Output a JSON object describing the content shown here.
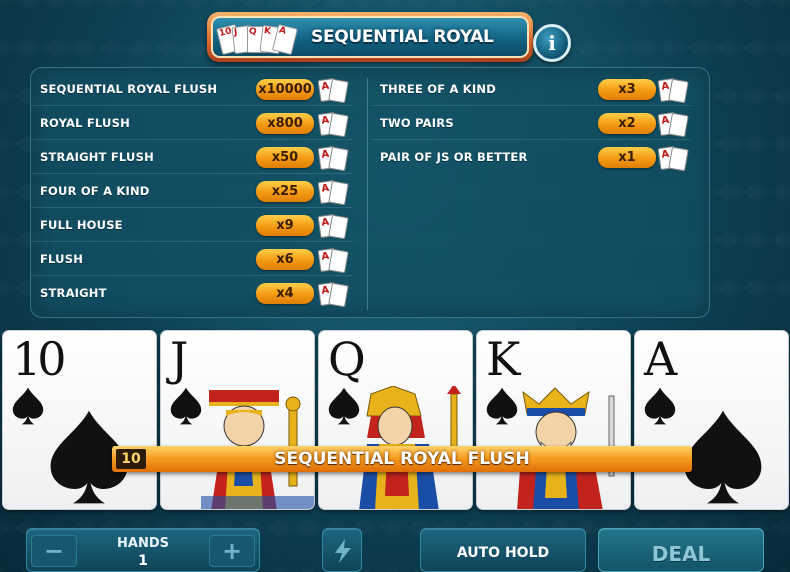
{
  "banner": {
    "title": "SEQUENTIAL ROYAL",
    "mini_cards": [
      "10",
      "J",
      "Q",
      "K",
      "A"
    ]
  },
  "info_button": {
    "label": "i"
  },
  "paytable": {
    "left": [
      {
        "name": "SEQUENTIAL ROYAL FLUSH",
        "multiplier": "x10000"
      },
      {
        "name": "ROYAL FLUSH",
        "multiplier": "x800"
      },
      {
        "name": "STRAIGHT FLUSH",
        "multiplier": "x50"
      },
      {
        "name": "FOUR OF A KIND",
        "multiplier": "x25"
      },
      {
        "name": "FULL HOUSE",
        "multiplier": "x9"
      },
      {
        "name": "FLUSH",
        "multiplier": "x6"
      },
      {
        "name": "STRAIGHT",
        "multiplier": "x4"
      }
    ],
    "right": [
      {
        "name": "THREE OF A KIND",
        "multiplier": "x3"
      },
      {
        "name": "TWO PAIRS",
        "multiplier": "x2"
      },
      {
        "name": "PAIR OF JS OR BETTER",
        "multiplier": "x1"
      }
    ],
    "icon_card_letter": "A"
  },
  "cards": [
    {
      "rank": "10",
      "suit": "spade"
    },
    {
      "rank": "J",
      "suit": "spade"
    },
    {
      "rank": "Q",
      "suit": "spade"
    },
    {
      "rank": "K",
      "suit": "spade"
    },
    {
      "rank": "A",
      "suit": "spade"
    }
  ],
  "win": {
    "hand_number": "10",
    "text": "SEQUENTIAL ROYAL FLUSH"
  },
  "controls": {
    "hands_label": "HANDS",
    "hands_value": "1",
    "minus": "−",
    "plus": "+",
    "auto_hold": "AUTO HOLD",
    "deal": "DEAL"
  },
  "colors": {
    "accent_orange": "#f59a1e",
    "panel_teal": "#124e62",
    "background": "#0d4054"
  }
}
